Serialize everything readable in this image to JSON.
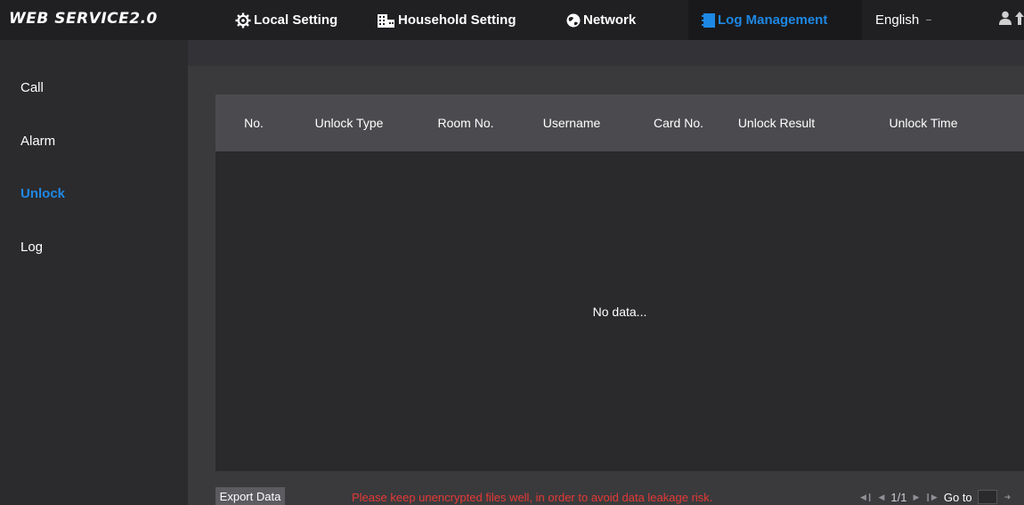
{
  "header": {
    "logo": "WEB SERVICE2.0",
    "nav": [
      {
        "label": "Local Setting",
        "icon": "gear-icon"
      },
      {
        "label": "Household Setting",
        "icon": "building-icon"
      },
      {
        "label": "Network",
        "icon": "globe-icon"
      },
      {
        "label": "Log Management",
        "icon": "notebook-icon",
        "active": true
      }
    ],
    "language": "English",
    "accent_color": "#1e88e5"
  },
  "sidebar": {
    "items": [
      {
        "label": "Call"
      },
      {
        "label": "Alarm"
      },
      {
        "label": "Unlock",
        "active": true
      },
      {
        "label": "Log"
      }
    ]
  },
  "table": {
    "columns": [
      "No.",
      "Unlock Type",
      "Room No.",
      "Username",
      "Card No.",
      "Unlock Result",
      "Unlock Time"
    ],
    "rows": [],
    "empty_text": "No data..."
  },
  "footer": {
    "export_label": "Export Data",
    "warning": "Please keep unencrypted files well, in order to avoid data leakage risk.",
    "page_info": "1/1",
    "goto_label": "Go to",
    "goto_value": ""
  }
}
